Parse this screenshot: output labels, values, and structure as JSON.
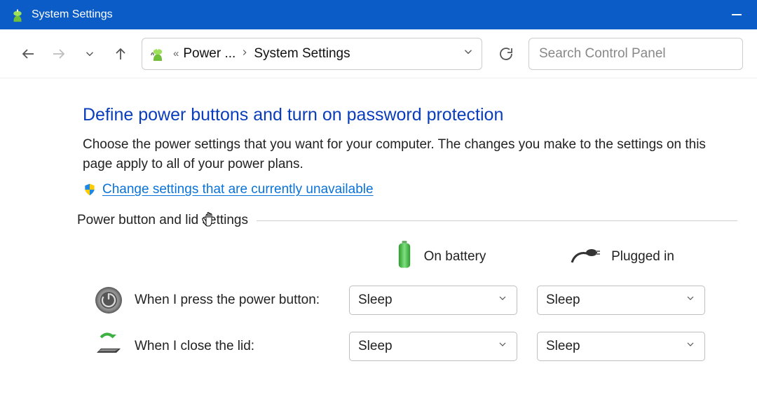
{
  "window": {
    "title": "System Settings"
  },
  "breadcrumb": {
    "parent_truncated": "Power ...",
    "current": "System Settings"
  },
  "search": {
    "placeholder": "Search Control Panel"
  },
  "main": {
    "heading": "Define power buttons and turn on password protection",
    "description": "Choose the power settings that you want for your computer. The changes you make to the settings on this page apply to all of your power plans.",
    "change_link": "Change settings that are currently unavailable",
    "group_label": "Power button and lid settings",
    "columns": {
      "battery": "On battery",
      "plugged": "Plugged in"
    },
    "rows": [
      {
        "label": "When I press the power button:",
        "battery_value": "Sleep",
        "plugged_value": "Sleep"
      },
      {
        "label": "When I close the lid:",
        "battery_value": "Sleep",
        "plugged_value": "Sleep"
      }
    ]
  }
}
